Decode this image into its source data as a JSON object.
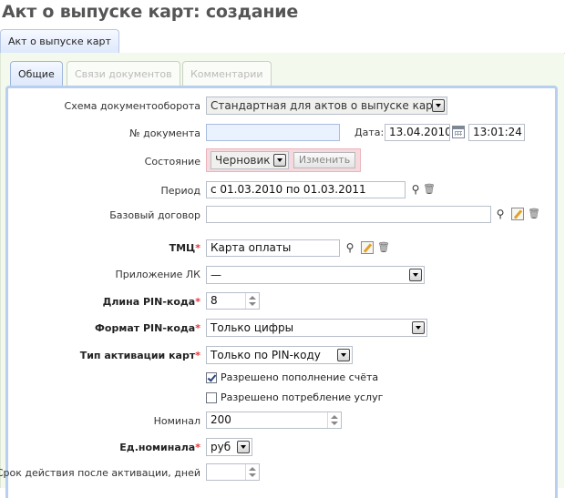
{
  "page": {
    "title": "Акт о выпуске карт: создание"
  },
  "outer_tab": {
    "label": "Акт о выпуске карт"
  },
  "inner_tabs": [
    {
      "label": "Общие",
      "active": true
    },
    {
      "label": "Связи документов",
      "active": false
    },
    {
      "label": "Комментарии",
      "active": false
    }
  ],
  "form": {
    "workflow_schema": {
      "label": "Схема документооборота",
      "value": "Стандартная для актов о выпуске карт"
    },
    "doc_number": {
      "label": "№ документа",
      "value": ""
    },
    "date": {
      "label": "Дата:",
      "value": "13.04.2010",
      "time": "13:01:24"
    },
    "state": {
      "label": "Состояние",
      "value": "Черновик",
      "change_button": "Изменить"
    },
    "period": {
      "label": "Период",
      "value": "с 01.03.2010 по 01.03.2011"
    },
    "base_contract": {
      "label": "Базовый договор",
      "value": ""
    },
    "tmc": {
      "label": "ТМЦ",
      "required": "*",
      "value": "Карта оплаты"
    },
    "lk_app": {
      "label": "Приложение ЛК",
      "value": "—"
    },
    "pin_length": {
      "label": "Длина PIN-кода",
      "required": "*",
      "value": "8"
    },
    "pin_format": {
      "label": "Формат PIN-кода",
      "required": "*",
      "value": "Только цифры"
    },
    "activation_type": {
      "label": "Тип активации карт",
      "required": "*",
      "value": "Только по PIN-коду"
    },
    "allow_topup": {
      "label": "Разрешено пополнение счёта",
      "checked": true
    },
    "allow_consumption": {
      "label": "Разрешено потребление услуг",
      "checked": false
    },
    "nominal": {
      "label": "Номинал",
      "value": "200"
    },
    "nominal_unit": {
      "label": "Ед.номинала",
      "required": "*",
      "value": "руб"
    },
    "validity_days": {
      "label": "Срок действия после активации, дней",
      "value": ""
    }
  },
  "icons": {
    "calendar": "calendar-icon",
    "search": "binoculars-icon",
    "delete": "trash-icon",
    "edit": "edit-icon"
  }
}
